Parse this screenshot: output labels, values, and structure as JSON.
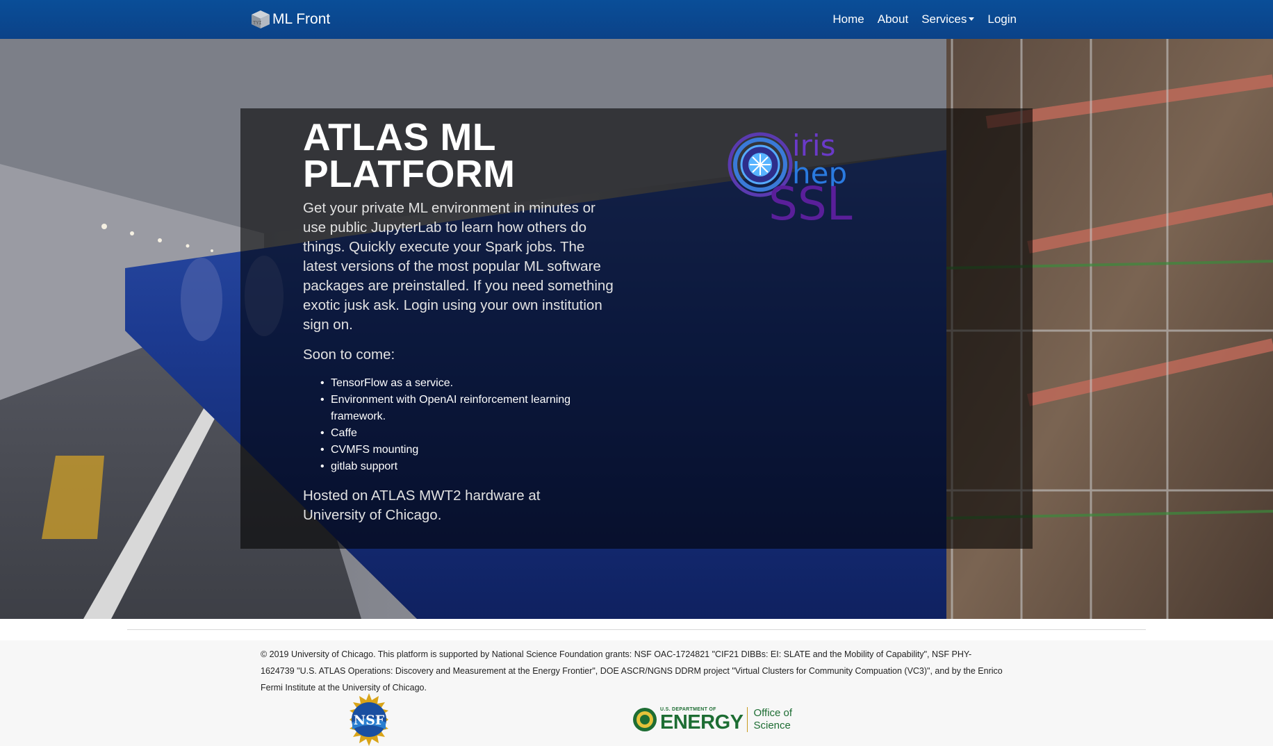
{
  "nav": {
    "brand": "ML Front",
    "links": [
      "Home",
      "About",
      "Services",
      "Login"
    ]
  },
  "hero": {
    "title_line1": "ATLAS ML",
    "title_line2": "PLATFORM",
    "lead": "Get your private ML environment in minutes or use public JupyterLab to learn how others do things. Quickly execute your Spark jobs. The latest versions of the most popular ML software packages are preinstalled. If you need something exotic jusk ask. Login using your own institution sign on.",
    "soon_label": "Soon to come:",
    "features": [
      "TensorFlow as a service.",
      "Environment with OpenAI reinforcement learning framework.",
      "Caffe",
      "CVMFS mounting",
      "gitlab support"
    ],
    "hosted": "Hosted on ATLAS MWT2 hardware at University of Chicago.",
    "logo": {
      "line1": "iris",
      "line2": "hep",
      "line3": "SSL"
    }
  },
  "footer": {
    "text": "© 2019 University of Chicago. This platform is supported by National Science Foundation grants: NSF OAC-1724821 \"CIF21 DIBBs: EI: SLATE and the Mobility of Capability\", NSF PHY-1624739 \"U.S. ATLAS Operations: Discovery and Measurement at the Energy Frontier\", DOE ASCR/NGNS DDRM project \"Virtual Clusters for Community Compuation (VC3)\", and by the Enrico Fermi Institute at the University of Chicago.",
    "nsf_logo_text": "NSF",
    "doe": {
      "small": "U.S. DEPARTMENT OF",
      "big": "ENERGY",
      "office_line1": "Office of",
      "office_line2": "Science"
    }
  },
  "colors": {
    "navbar": "#0b4a92",
    "logo_purple": "#5a1f9a",
    "logo_blue": "#2a6ad0",
    "doe_green": "#1d6d33"
  }
}
